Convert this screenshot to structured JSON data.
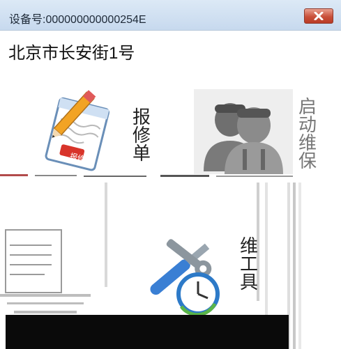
{
  "window": {
    "title": "设备号:000000000000254E"
  },
  "location": {
    "address": "北京市长安街1号"
  },
  "tiles": [
    {
      "label_chars": [
        "报",
        "修",
        "单"
      ],
      "icon": "repair-order-icon",
      "badge_text": "报修"
    },
    {
      "label_chars": [
        "启",
        "动",
        "维",
        "保"
      ],
      "icon": "maintenance-workers-icon"
    },
    {
      "label_chars": [
        "维",
        "工",
        "具"
      ],
      "icon": "tools-clock-icon"
    }
  ],
  "colors": {
    "titlebar": "#c7d9ee",
    "close_button": "#c9503a",
    "tile_bg": "#eeeeee",
    "dark_strip": "#0a0a0a"
  }
}
